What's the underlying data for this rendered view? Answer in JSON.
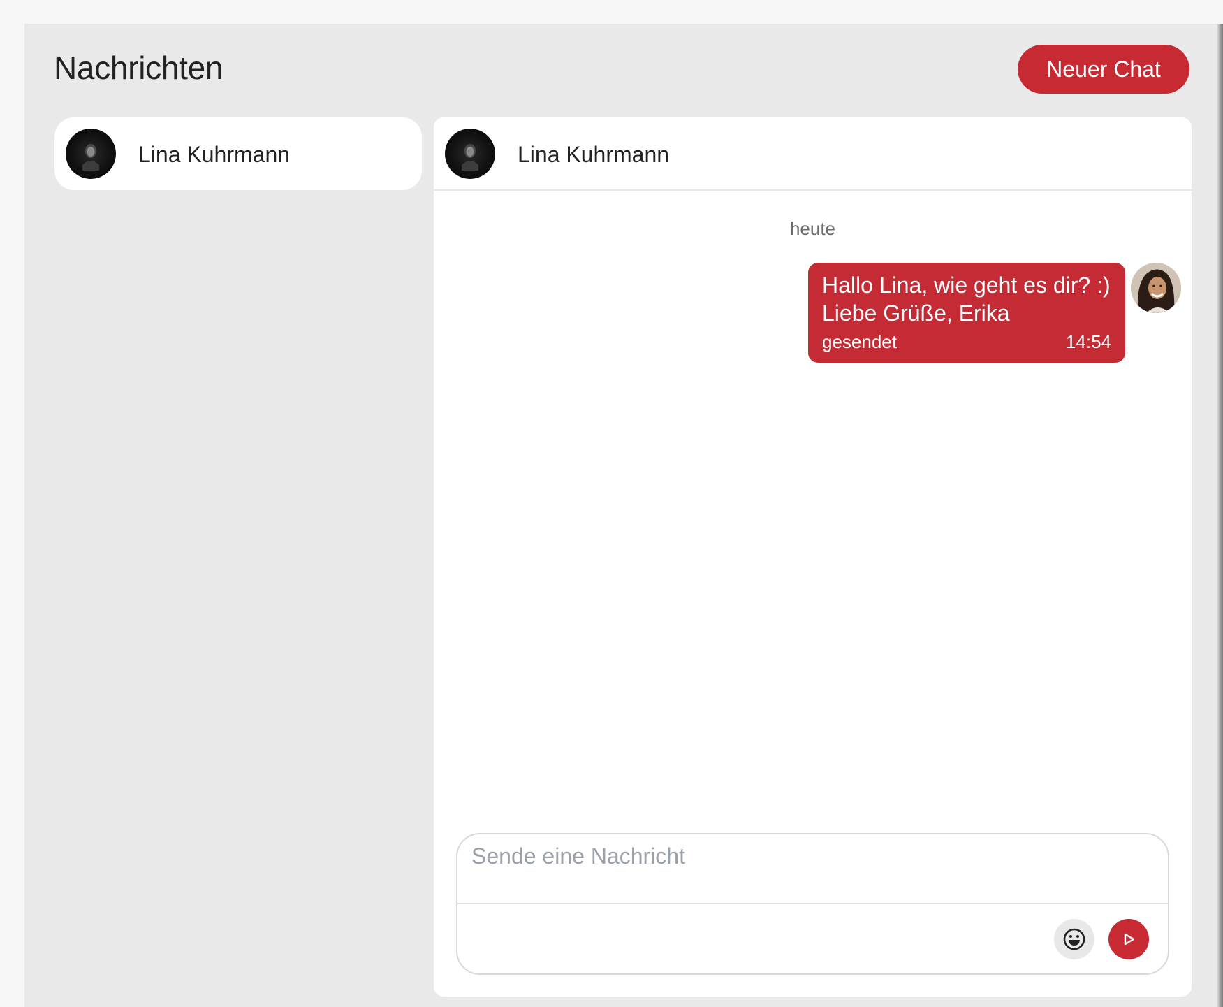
{
  "header": {
    "title": "Nachrichten",
    "new_chat_label": "Neuer Chat"
  },
  "contacts": [
    {
      "name": "Lina Kuhrmann",
      "avatar_icon": "user-photo-avatar"
    }
  ],
  "chat": {
    "partner_name": "Lina Kuhrmann",
    "day_label": "heute",
    "messages": [
      {
        "text": "Hallo Lina, wie geht es dir? :)\nLiebe Grüße, Erika",
        "status": "gesendet",
        "time": "14:54",
        "direction": "outgoing"
      }
    ]
  },
  "composer": {
    "placeholder": "Sende eine Nachricht",
    "value": "",
    "emoji_icon": "smiley-icon",
    "send_icon": "send-icon"
  },
  "colors": {
    "accent": "#c82a33",
    "background": "#e9e9e9",
    "panel": "#ffffff",
    "text": "#222222",
    "muted": "#6d6d6d"
  }
}
